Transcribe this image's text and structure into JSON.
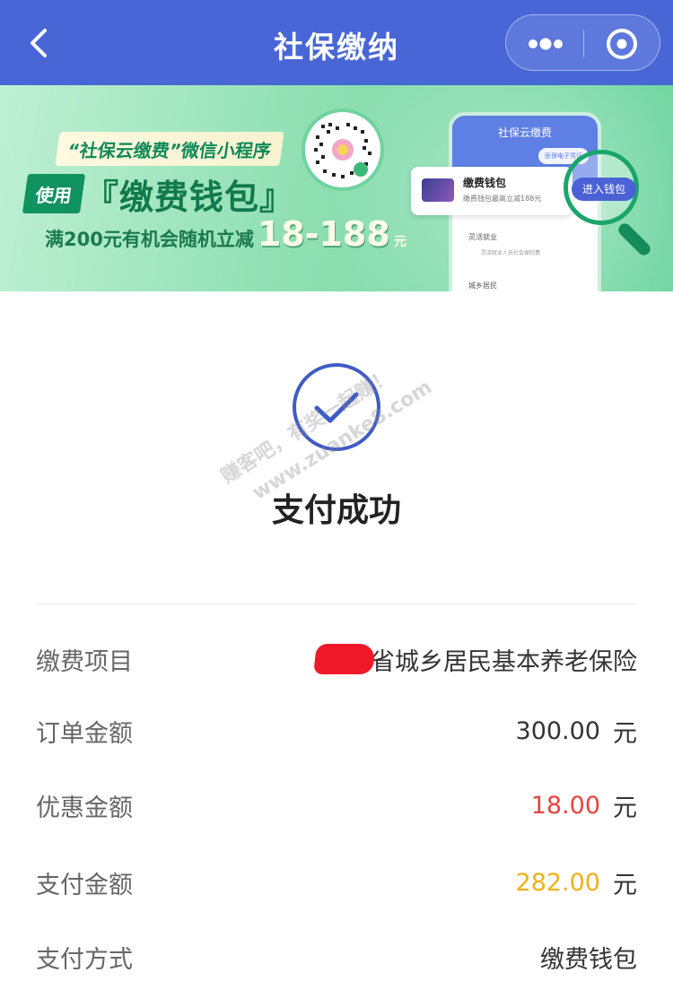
{
  "header": {
    "title": "社保缴纳",
    "back_icon": "chevron-left-icon",
    "more_icon": "more-dots-icon",
    "close_icon": "target-circle-icon",
    "background": "#4866d6"
  },
  "banner": {
    "tagline": "“社保云缴费”微信小程序",
    "use_label": "使用",
    "wallet_title": "『缴费钱包』",
    "promo_text": "满200元有机会随机立减",
    "promo_amount": "18-188",
    "promo_unit": "元",
    "phone_title": "社保云缴费",
    "phone_badge": "医保电子凭证",
    "wallet_card_title": "缴费钱包",
    "wallet_card_sub": "缴费钱包最高立减188元",
    "enter_button": "进入钱包",
    "phone_row1": "灵活就业",
    "phone_row1_sub": "灵活就业人员社会保险费",
    "phone_row2": "城乡居民"
  },
  "result": {
    "status": "支付成功",
    "status_icon": "check-circle-icon",
    "accent": "#3f5bc4"
  },
  "watermark": {
    "line1": "赚客吧，有奖一起赚！",
    "line2": "www.zuanke8.com"
  },
  "details": [
    {
      "label": "缴费项目",
      "value": "省城乡居民基本养老保险",
      "unit": ""
    },
    {
      "label": "订单金额",
      "value": "300.00",
      "unit": "元"
    },
    {
      "label": "优惠金额",
      "value": "18.00",
      "unit": "元",
      "color": "#e8433d"
    },
    {
      "label": "支付金额",
      "value": "282.00",
      "unit": "元",
      "color": "#f0b017"
    },
    {
      "label": "支付方式",
      "value": "缴费钱包",
      "unit": ""
    }
  ]
}
